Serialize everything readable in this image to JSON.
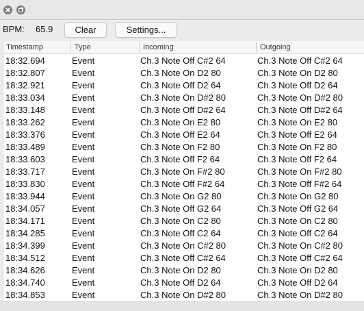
{
  "window": {
    "close_icon": "close-icon",
    "restore_icon": "restore-icon"
  },
  "toolbar": {
    "bpm_label": "BPM:",
    "bpm_value": "65.9",
    "clear_label": "Clear",
    "settings_label": "Settings..."
  },
  "table": {
    "columns": [
      "Timestamp",
      "Type",
      "Incoming",
      "Outgoing"
    ],
    "rows": [
      {
        "timestamp": "18:32.694",
        "type": "Event",
        "incoming": "Ch.3 Note Off C#2 64",
        "outgoing": "Ch.3 Note Off C#2 64"
      },
      {
        "timestamp": "18:32.807",
        "type": "Event",
        "incoming": "Ch.3 Note On D2 80",
        "outgoing": "Ch.3 Note On D2 80"
      },
      {
        "timestamp": "18:32.921",
        "type": "Event",
        "incoming": "Ch.3 Note Off D2 64",
        "outgoing": "Ch.3 Note Off D2 64"
      },
      {
        "timestamp": "18:33.034",
        "type": "Event",
        "incoming": "Ch.3 Note On D#2 80",
        "outgoing": "Ch.3 Note On D#2 80"
      },
      {
        "timestamp": "18:33.148",
        "type": "Event",
        "incoming": "Ch.3 Note Off D#2 64",
        "outgoing": "Ch.3 Note Off D#2 64"
      },
      {
        "timestamp": "18:33.262",
        "type": "Event",
        "incoming": "Ch.3 Note On E2 80",
        "outgoing": "Ch.3 Note On E2 80"
      },
      {
        "timestamp": "18:33.376",
        "type": "Event",
        "incoming": "Ch.3 Note Off E2 64",
        "outgoing": "Ch.3 Note Off E2 64"
      },
      {
        "timestamp": "18:33.489",
        "type": "Event",
        "incoming": "Ch.3 Note On F2 80",
        "outgoing": "Ch.3 Note On F2 80"
      },
      {
        "timestamp": "18:33.603",
        "type": "Event",
        "incoming": "Ch.3 Note Off F2 64",
        "outgoing": "Ch.3 Note Off F2 64"
      },
      {
        "timestamp": "18:33.717",
        "type": "Event",
        "incoming": "Ch.3 Note On F#2 80",
        "outgoing": "Ch.3 Note On F#2 80"
      },
      {
        "timestamp": "18:33.830",
        "type": "Event",
        "incoming": "Ch.3 Note Off F#2 64",
        "outgoing": "Ch.3 Note Off F#2 64"
      },
      {
        "timestamp": "18:33.944",
        "type": "Event",
        "incoming": "Ch.3 Note On G2 80",
        "outgoing": "Ch.3 Note On G2 80"
      },
      {
        "timestamp": "18:34.057",
        "type": "Event",
        "incoming": "Ch.3 Note Off G2 64",
        "outgoing": "Ch.3 Note Off G2 64"
      },
      {
        "timestamp": "18:34.171",
        "type": "Event",
        "incoming": "Ch.3 Note On C2 80",
        "outgoing": "Ch.3 Note On C2 80"
      },
      {
        "timestamp": "18:34.285",
        "type": "Event",
        "incoming": "Ch.3 Note Off C2 64",
        "outgoing": "Ch.3 Note Off C2 64"
      },
      {
        "timestamp": "18:34.399",
        "type": "Event",
        "incoming": "Ch.3 Note On C#2 80",
        "outgoing": "Ch.3 Note On C#2 80"
      },
      {
        "timestamp": "18:34.512",
        "type": "Event",
        "incoming": "Ch.3 Note Off C#2 64",
        "outgoing": "Ch.3 Note Off C#2 64"
      },
      {
        "timestamp": "18:34.626",
        "type": "Event",
        "incoming": "Ch.3 Note On D2 80",
        "outgoing": "Ch.3 Note On D2 80"
      },
      {
        "timestamp": "18:34.740",
        "type": "Event",
        "incoming": "Ch.3 Note Off D2 64",
        "outgoing": "Ch.3 Note Off D2 64"
      },
      {
        "timestamp": "18:34.853",
        "type": "Event",
        "incoming": "Ch.3 Note On D#2 80",
        "outgoing": "Ch.3 Note On D#2 80"
      }
    ]
  }
}
